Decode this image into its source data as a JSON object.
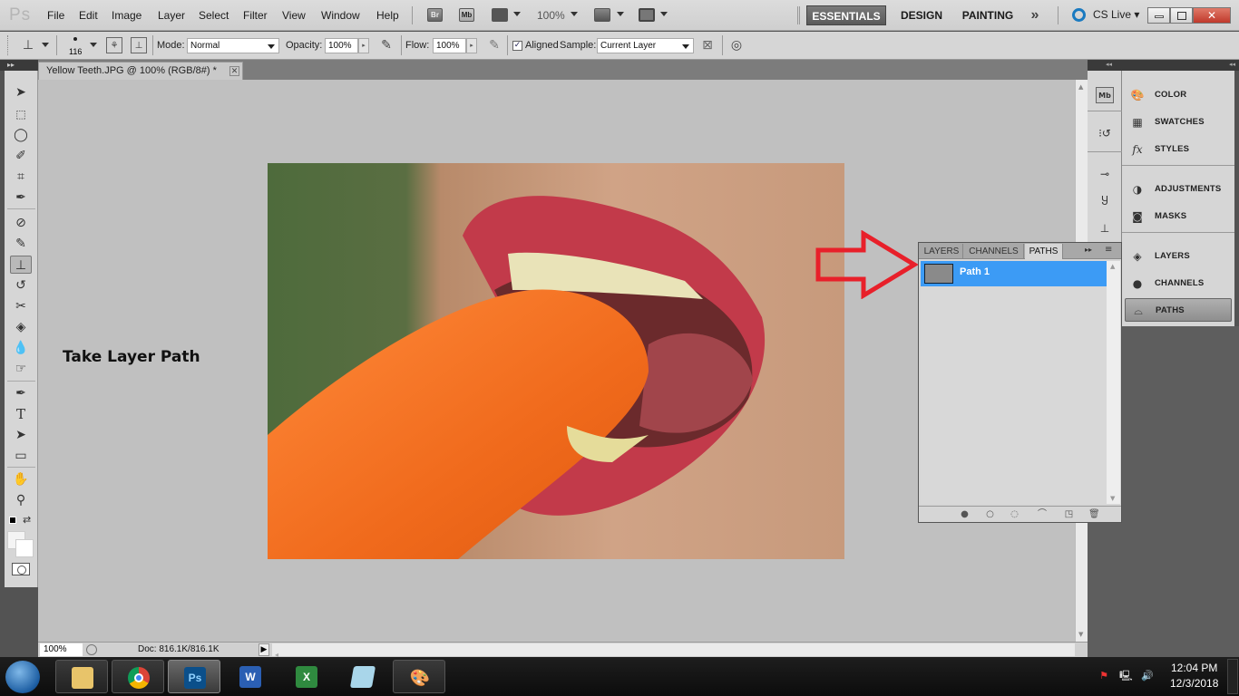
{
  "app": {
    "logo": "Ps",
    "menu": [
      "File",
      "Edit",
      "Image",
      "Layer",
      "Select",
      "Filter",
      "View",
      "Window",
      "Help"
    ],
    "appbar": {
      "bridge_label": "Br",
      "minibridge_label": "Mb",
      "zoom": "100%"
    },
    "workspaces": [
      "ESSENTIALS",
      "DESIGN",
      "PAINTING"
    ],
    "active_workspace": "ESSENTIALS",
    "more_workspaces": "»",
    "cs_live": "CS Live ▾"
  },
  "options_bar": {
    "brush_size": "116",
    "mode_label": "Mode:",
    "mode_value": "Normal",
    "opacity_label": "Opacity:",
    "opacity_value": "100%",
    "flow_label": "Flow:",
    "flow_value": "100%",
    "aligned_label": "Aligned",
    "aligned_checked": true,
    "sample_label": "Sample:",
    "sample_value": "Current Layer"
  },
  "document": {
    "tab_title": "Yellow Teeth.JPG @ 100% (RGB/8#) *",
    "close_glyph": "✕",
    "status_zoom": "100%",
    "doc_info": "Doc: 816.1K/816.1K"
  },
  "annotation": {
    "text": "Take Layer Path",
    "arrow_color": "#e8202a"
  },
  "paths_panel": {
    "tabs": [
      "LAYERS",
      "CHANNELS",
      "PATHS"
    ],
    "active_tab": "PATHS",
    "items": [
      {
        "name": "Path 1",
        "selected": true
      }
    ],
    "selection_color": "#3c9bf5"
  },
  "dock": {
    "groups": [
      [
        {
          "label": "COLOR",
          "icon": "palette-icon"
        },
        {
          "label": "SWATCHES",
          "icon": "swatches-icon"
        },
        {
          "label": "STYLES",
          "icon": "fx-icon"
        }
      ],
      [
        {
          "label": "ADJUSTMENTS",
          "icon": "adjustments-icon"
        },
        {
          "label": "MASKS",
          "icon": "mask-icon"
        }
      ],
      [
        {
          "label": "LAYERS",
          "icon": "layers-icon"
        },
        {
          "label": "CHANNELS",
          "icon": "channels-icon"
        },
        {
          "label": "PATHS",
          "icon": "paths-icon",
          "active": true
        }
      ]
    ]
  },
  "taskbar": {
    "apps": [
      "File Explorer",
      "Google Chrome",
      "Adobe Photoshop",
      "Microsoft Word",
      "Microsoft Excel",
      "Notepad",
      "Paint"
    ],
    "active_app": "Adobe Photoshop",
    "time": "12:04 PM",
    "date": "12/3/2018"
  }
}
